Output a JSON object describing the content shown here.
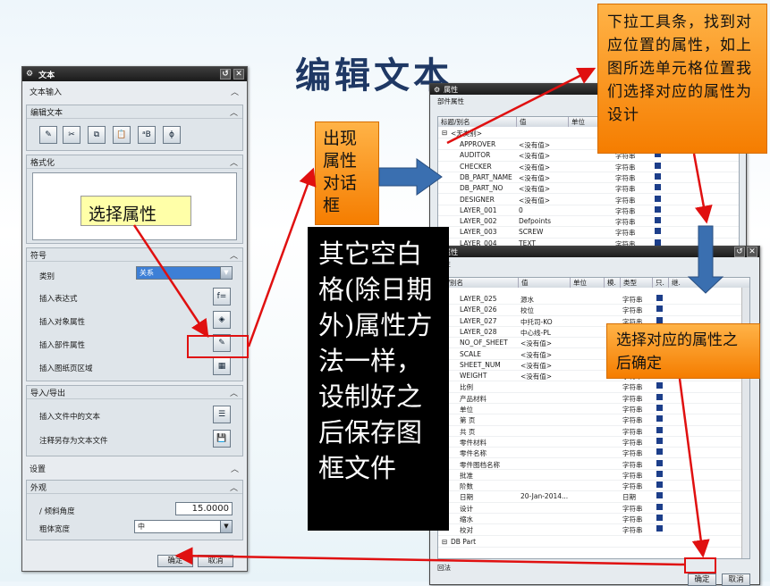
{
  "slide_title": "编辑文本",
  "dialog": {
    "title": "文本",
    "sections": {
      "text_input": "文本输入",
      "edit_text": "编辑文本",
      "format": "格式化",
      "symbols": "符号",
      "import_export": "导入/导出",
      "settings": "设置",
      "appearance": "外观"
    },
    "category_label": "类别",
    "category_value": "关系",
    "insert_expression": "插入表达式",
    "insert_object_attr": "插入对象属性",
    "insert_part_attr": "插入部件属性",
    "insert_drawing_region": "插入图纸页区域",
    "insert_text_file": "插入文件中的文本",
    "save_note_as_file": "注释另存为文本文件",
    "slant_angle_label": "倾斜角度",
    "slant_angle_value": "15.0000",
    "line_width_label": "粗体宽度",
    "line_width_value": "中",
    "ok": "确定",
    "cancel": "取消",
    "edit_icons": [
      "✎",
      "✂",
      "⧉",
      "📋",
      "ᵃB",
      "ϕ"
    ]
  },
  "prop_window_top": {
    "title": "属性",
    "group": "部件属性",
    "headers": [
      "标题/别名",
      "值",
      "单位",
      "类型"
    ],
    "tree_root": "<无类别>",
    "rows": [
      {
        "name": "APPROVER",
        "value": "<没有值>",
        "type": "字符串"
      },
      {
        "name": "AUDITOR",
        "value": "<没有值>",
        "type": "字符串"
      },
      {
        "name": "CHECKER",
        "value": "<没有值>",
        "type": "字符串"
      },
      {
        "name": "DB_PART_NAME",
        "value": "<没有值>",
        "type": "字符串"
      },
      {
        "name": "DB_PART_NO",
        "value": "<没有值>",
        "type": "字符串"
      },
      {
        "name": "DESIGNER",
        "value": "<没有值>",
        "type": "字符串"
      },
      {
        "name": "LAYER_001",
        "value": "0",
        "type": "字符串"
      },
      {
        "name": "LAYER_002",
        "value": "Defpoints",
        "type": "字符串"
      },
      {
        "name": "LAYER_003",
        "value": "SCREW",
        "type": "字符串"
      },
      {
        "name": "LAYER_004",
        "value": "TEXT",
        "type": "字符串"
      }
    ]
  },
  "prop_window_bottom": {
    "title": "属性",
    "group": "属性",
    "headers": [
      "题/别名",
      "值",
      "单位",
      "模.",
      "类型",
      "只.",
      "继."
    ],
    "rows": [
      {
        "name": "LAYER_025",
        "value": "源水",
        "type": "字符串"
      },
      {
        "name": "LAYER_026",
        "value": "校位",
        "type": "字符串"
      },
      {
        "name": "LAYER_027",
        "value": "中托司-KO",
        "type": "字符串"
      },
      {
        "name": "LAYER_028",
        "value": "中心线-PL",
        "type": "字符串"
      },
      {
        "name": "NO_OF_SHEET",
        "value": "<没有值>",
        "type": "字符串"
      },
      {
        "name": "SCALE",
        "value": "<没有值>",
        "type": "字符串"
      },
      {
        "name": "SHEET_NUM",
        "value": "<没有值>",
        "type": "字符串"
      },
      {
        "name": "WEIGHT",
        "value": "<没有值>",
        "type": "字符串"
      },
      {
        "name": "比例",
        "value": "",
        "type": "字符串"
      },
      {
        "name": "产品材料",
        "value": "",
        "type": "字符串"
      },
      {
        "name": "单位",
        "value": "",
        "type": "字符串"
      },
      {
        "name": "第 页",
        "value": "",
        "type": "字符串"
      },
      {
        "name": "共 页",
        "value": "",
        "type": "字符串"
      },
      {
        "name": "零件材料",
        "value": "",
        "type": "字符串"
      },
      {
        "name": "零件名称",
        "value": "",
        "type": "字符串"
      },
      {
        "name": "零件图档名称",
        "value": "",
        "type": "字符串"
      },
      {
        "name": "批准",
        "value": "",
        "type": "字符串"
      },
      {
        "name": "阶数",
        "value": "",
        "type": "字符串"
      },
      {
        "name": "日期",
        "value": "20-Jan-2014...",
        "type": "日期"
      },
      {
        "name": "设计",
        "value": "",
        "type": "字符串"
      },
      {
        "name": "缩水",
        "value": "",
        "type": "字符串"
      },
      {
        "name": "校对",
        "value": "",
        "type": "字符串"
      }
    ],
    "db_part": "DB Part",
    "footer_label": "回法",
    "ok": "确定",
    "cancel": "取消"
  },
  "callouts": {
    "select_attr": "选择属性",
    "dialog_appears": "出现属性对话框",
    "dropdown_tip": "下拉工具条，找到对应位置的属性，如上图所选单元格位置我们选择对应的属性为设计",
    "other_cells": "其它空白格(除日期外)属性方法一样，设制好之后保存图框文件",
    "confirm_tip": "选择对应的属性之后确定"
  },
  "colors": {
    "callout": "#f57d00",
    "arrow_red": "#e01010",
    "arrow_blue": "#3a6fb0",
    "title": "#1f3864"
  }
}
